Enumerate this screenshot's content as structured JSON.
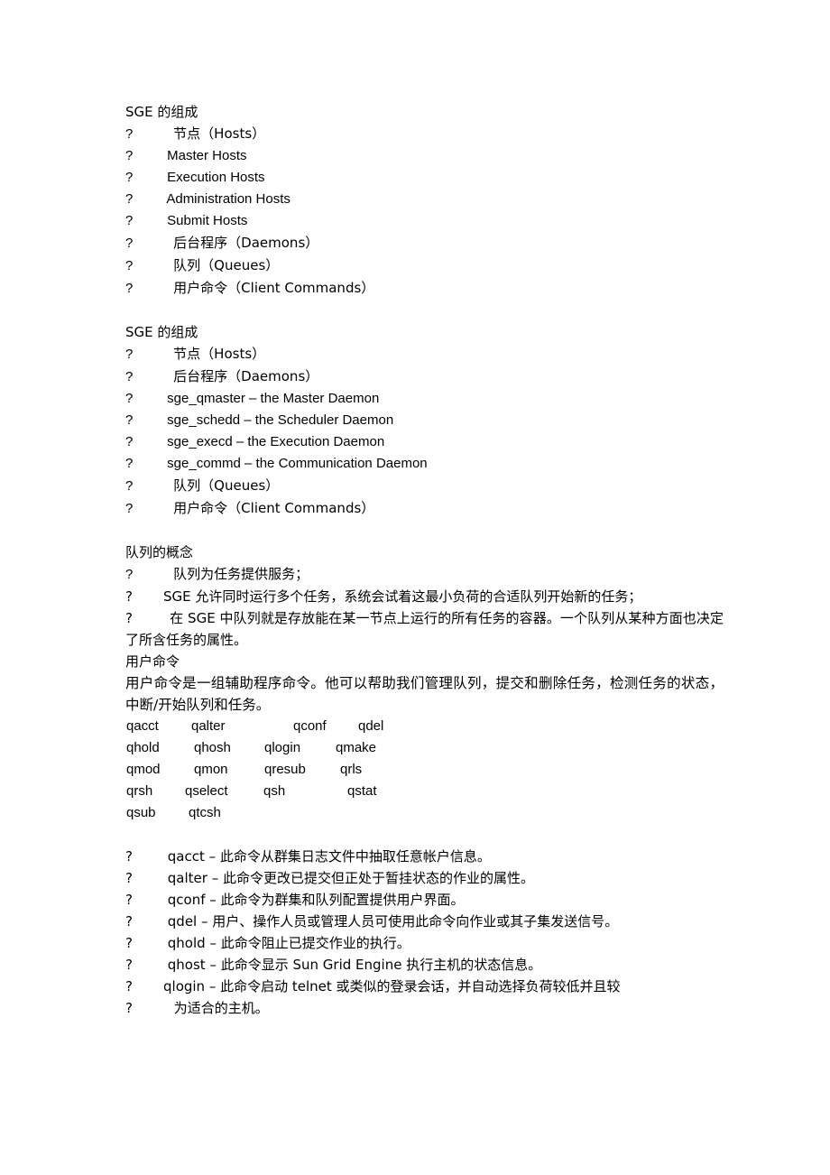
{
  "document": {
    "bullet_marker": "?",
    "sections": [
      {
        "id": "sge-composition-1",
        "heading": "SGE 的组成",
        "items": [
          {
            "text": "节点（Hosts）",
            "cjk_lead": true
          },
          {
            "text": "Master Hosts",
            "cjk_lead": false
          },
          {
            "text": "Execution Hosts",
            "cjk_lead": false
          },
          {
            "text": "Administration Hosts",
            "cjk_lead": false
          },
          {
            "text": "Submit Hosts",
            "cjk_lead": false
          },
          {
            "text": "后台程序（Daemons）",
            "cjk_lead": true
          },
          {
            "text": "队列（Queues）",
            "cjk_lead": true
          },
          {
            "text": "用户命令（Client Commands）",
            "cjk_lead": true
          }
        ]
      },
      {
        "id": "sge-composition-2",
        "heading": "SGE 的组成",
        "items": [
          {
            "text": "节点（Hosts）",
            "cjk_lead": true
          },
          {
            "text": "后台程序（Daemons）",
            "cjk_lead": true
          },
          {
            "text": "sge_qmaster – the Master Daemon",
            "cjk_lead": false
          },
          {
            "text": "sge_schedd – the Scheduler Daemon",
            "cjk_lead": false
          },
          {
            "text": "sge_execd – the Execution Daemon",
            "cjk_lead": false
          },
          {
            "text": "sge_commd – the Communication Daemon",
            "cjk_lead": false
          },
          {
            "text": "队列（Queues）",
            "cjk_lead": true
          },
          {
            "text": "用户命令（Client Commands）",
            "cjk_lead": true
          }
        ]
      }
    ],
    "queue_concept": {
      "heading": "队列的概念",
      "items": [
        "队列为任务提供服务；",
        "SGE 允许同时运行多个任务，系统会试着这最小负荷的合适队列开始新的任务；",
        "在 SGE 中队列就是存放能在某一节点上运行的所有任务的容器。一个队列从某种方面也决定了所含任务的属性。"
      ]
    },
    "user_commands": {
      "heading": "用户命令",
      "intro": "用户命令是一组辅助程序命令。他可以帮助我们管理队列，提交和删除任务，检测任务的状态，中断/开始队列和任务。",
      "command_table": [
        [
          "qacct",
          "qalter",
          "qconf",
          "qdel"
        ],
        [
          "qhold",
          "qhosh",
          "qlogin",
          "qmake"
        ],
        [
          "qmod",
          "qmon",
          "qresub",
          "qrls"
        ],
        [
          "qrsh",
          "qselect",
          "qsh",
          "qstat"
        ],
        [
          "qsub",
          "qtcsh",
          "",
          ""
        ]
      ],
      "descriptions": [
        "qacct – 此命令从群集日志文件中抽取任意帐户信息。",
        "qalter – 此命令更改已提交但正处于暂挂状态的作业的属性。",
        "qconf – 此命令为群集和队列配置提供用户界面。",
        "qdel – 用户、操作人员或管理人员可使用此命令向作业或其子集发送信号。",
        "qhold – 此命令阻止已提交作业的执行。",
        "qhost – 此命令显示 Sun Grid Engine  执行主机的状态信息。",
        "qlogin – 此命令启动 telnet  或类似的登录会话，并自动选择负荷较低并且较",
        "为适合的主机。"
      ]
    }
  }
}
